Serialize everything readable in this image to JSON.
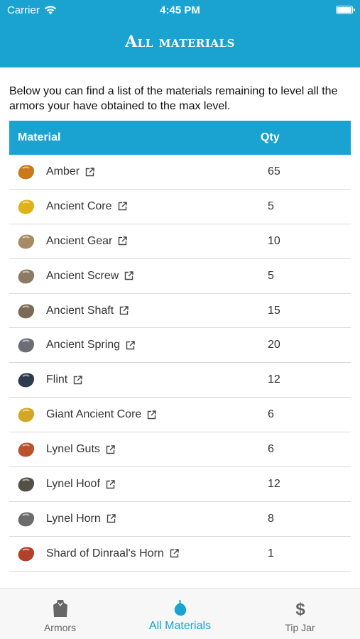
{
  "status_bar": {
    "carrier": "Carrier",
    "time": "4:45 PM"
  },
  "header": {
    "title": "All materials"
  },
  "intro": "Below you can find a list of the materials remaining to level all the armors your have obtained to the max level.",
  "table": {
    "columns": [
      "Material",
      "Qty"
    ],
    "rows": [
      {
        "name": "Amber",
        "qty": "65",
        "icon": "amber-icon",
        "color": "#c9781a"
      },
      {
        "name": "Ancient Core",
        "qty": "5",
        "icon": "ancient-core-icon",
        "color": "#e0b21a"
      },
      {
        "name": "Ancient Gear",
        "qty": "10",
        "icon": "ancient-gear-icon",
        "color": "#a88a64"
      },
      {
        "name": "Ancient Screw",
        "qty": "5",
        "icon": "ancient-screw-icon",
        "color": "#8c7b62"
      },
      {
        "name": "Ancient Shaft",
        "qty": "15",
        "icon": "ancient-shaft-icon",
        "color": "#7d6a55"
      },
      {
        "name": "Ancient Spring",
        "qty": "20",
        "icon": "ancient-spring-icon",
        "color": "#6d6d78"
      },
      {
        "name": "Flint",
        "qty": "12",
        "icon": "flint-icon",
        "color": "#2f3a4f"
      },
      {
        "name": "Giant Ancient Core",
        "qty": "6",
        "icon": "giant-ancient-core-icon",
        "color": "#d4a626"
      },
      {
        "name": "Lynel Guts",
        "qty": "6",
        "icon": "lynel-guts-icon",
        "color": "#b9532b"
      },
      {
        "name": "Lynel Hoof",
        "qty": "12",
        "icon": "lynel-hoof-icon",
        "color": "#555046"
      },
      {
        "name": "Lynel Horn",
        "qty": "8",
        "icon": "lynel-horn-icon",
        "color": "#6b6b6b"
      },
      {
        "name": "Shard of Dinraal's Horn",
        "qty": "1",
        "icon": "dinraal-horn-icon",
        "color": "#b2402a"
      }
    ]
  },
  "tabbar": {
    "tabs": [
      {
        "label": "Armors",
        "icon": "armor-icon",
        "active": false
      },
      {
        "label": "All Materials",
        "icon": "material-drop-icon",
        "active": true
      },
      {
        "label": "Tip Jar",
        "icon": "dollar-icon",
        "active": false
      }
    ]
  },
  "colors": {
    "accent": "#1aa3d1",
    "divider": "#d9d9d9",
    "tab_inactive": "#666666"
  }
}
